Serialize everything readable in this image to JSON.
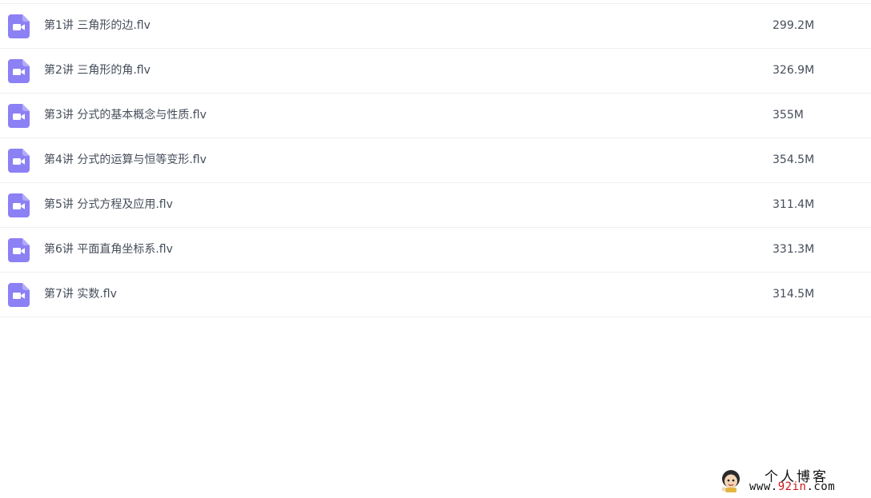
{
  "colors": {
    "icon_purple": "#8c80f5",
    "text": "#454d5a",
    "divider": "#f0f0f3",
    "watermark_accent": "#d01818"
  },
  "files": [
    {
      "name": "第1讲 三角形的边.flv",
      "size": "299.2M",
      "icon": "video-file-icon"
    },
    {
      "name": "第2讲 三角形的角.flv",
      "size": "326.9M",
      "icon": "video-file-icon"
    },
    {
      "name": "第3讲 分式的基本概念与性质.flv",
      "size": "355M",
      "icon": "video-file-icon"
    },
    {
      "name": "第4讲 分式的运算与恒等变形.flv",
      "size": "354.5M",
      "icon": "video-file-icon"
    },
    {
      "name": "第5讲 分式方程及应用.flv",
      "size": "311.4M",
      "icon": "video-file-icon"
    },
    {
      "name": "第6讲 平面直角坐标系.flv",
      "size": "331.3M",
      "icon": "video-file-icon"
    },
    {
      "name": "第7讲 实数.flv",
      "size": "314.5M",
      "icon": "video-file-icon"
    }
  ],
  "watermark": {
    "title": "个人博客",
    "url_prefix": "www.",
    "url_accent": "92in",
    "url_suffix": ".com"
  }
}
